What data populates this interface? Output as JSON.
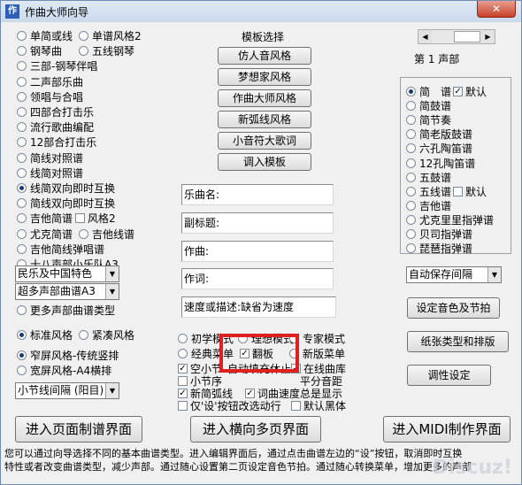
{
  "window": {
    "title": "作曲大师向导",
    "close": "✕"
  },
  "left_options": [
    [
      "单简或线",
      "单谱风格2"
    ],
    [
      "钢琴曲",
      "五线钢琴"
    ],
    [
      "三部-钢琴伴唱"
    ],
    [
      "二声部乐曲"
    ],
    [
      "领唱与合唱"
    ],
    [
      "四部合打击乐"
    ],
    [
      "流行歌曲编配"
    ],
    [
      "12部合打击乐"
    ],
    [
      "简线对照谱"
    ],
    [
      "线简对照谱"
    ],
    [
      "线简双向即时互换"
    ],
    [
      "简线双向即时互换"
    ],
    [
      "吉他简谱",
      "风格2"
    ],
    [
      "尤克简谱",
      "吉他线谱"
    ],
    [
      "吉他简线弹唱谱"
    ],
    [
      "十八声部小乐队A3"
    ]
  ],
  "combo_style": "民乐及中国特色",
  "combo_multi": "超多声部曲谱A3",
  "more_types": "更多声部曲谱类型",
  "style_radios": [
    "标准风格",
    "紧凑风格"
  ],
  "paper_radios": [
    "窄屏风格-传统竖排",
    "宽屏风格-A4横排"
  ],
  "combo_spacing": "小节线间隔 (阳目)",
  "template": {
    "title": "模板选择",
    "buttons": [
      "仿人音风格",
      "梦想家风格",
      "作曲大师风格",
      "新弧线风格",
      "小音符大歌词",
      "调入模板"
    ]
  },
  "fields": [
    {
      "label": "乐曲名:",
      "value": ""
    },
    {
      "label": "副标题:",
      "value": ""
    },
    {
      "label": "作曲:",
      "value": ""
    },
    {
      "label": "作词:",
      "value": ""
    },
    {
      "label": "速度或描述:缺省为速度",
      "value": ""
    }
  ],
  "modes": {
    "row1": [
      "初学模式",
      "理想模式",
      "专家模式"
    ],
    "row2": [
      "经典菜单",
      "翻板",
      "新版菜单"
    ],
    "checks": [
      "空小节",
      "自动填充休止",
      "在线曲库",
      "小节序",
      "平分音距",
      "新简弧线",
      "词曲速度总是显示",
      "仅'设'按钮改选动行",
      "默认黑体"
    ]
  },
  "measure": {
    "label": "第 1 声部"
  },
  "notation_types": [
    {
      "label": "简　谱",
      "extra": "默认"
    },
    {
      "label": "简鼓谱"
    },
    {
      "label": "简节奏"
    },
    {
      "label": "简老版鼓谱"
    },
    {
      "label": "六孔陶笛谱"
    },
    {
      "label": "12孔陶笛谱"
    },
    {
      "label": "五鼓谱"
    },
    {
      "label": "五线谱",
      "extra": "默认"
    },
    {
      "label": "吉他谱"
    },
    {
      "label": "尤克里里指弹谱"
    },
    {
      "label": "贝司指弹谱"
    },
    {
      "label": "琵琶指弹谱"
    }
  ],
  "autosave": "自动保存间隔",
  "right_buttons": [
    "设定音色及节拍",
    "纸张类型和排版",
    "调性设定"
  ],
  "bottom_buttons": [
    "进入页面制谱界面",
    "进入横向多页界面",
    "进入MIDI制作界面"
  ],
  "info_lines": [
    "您可以通过向导选择不同的基本曲谱类型。进入编辑界面后，通过点击曲谱左边的“设”按钮，取消即时互换",
    "特性或者改变曲谱类型，减少声部。通过随心设置第二页设定音色节拍。通过随心转换菜单，增加更多的声部"
  ],
  "watermark": "Discuz!",
  "colors": {
    "highlight_box": "#e02020",
    "title_bg": "#c9d9ec"
  }
}
